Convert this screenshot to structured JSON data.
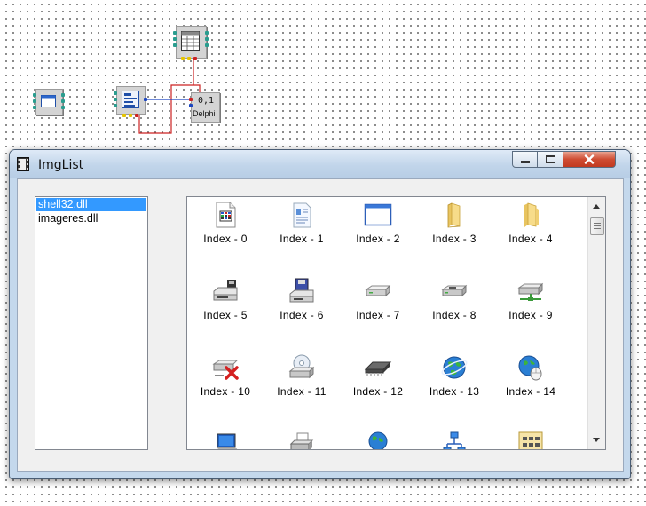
{
  "window": {
    "title": "ImgList",
    "minimize_label": "minimize",
    "maximize_label": "maximize",
    "close_label": "close"
  },
  "canvas": {
    "delphi_node_label": "Delphi",
    "delphi_node_digits": "0,1"
  },
  "dll_list": {
    "items": [
      "shell32.dll",
      "imageres.dll"
    ],
    "selected": "shell32.dll"
  },
  "icons": [
    {
      "label": "Index - 0",
      "icon": "document-chart-icon"
    },
    {
      "label": "Index - 1",
      "icon": "document-text-icon"
    },
    {
      "label": "Index - 2",
      "icon": "window-icon"
    },
    {
      "label": "Index - 3",
      "icon": "folder-icon"
    },
    {
      "label": "Index - 4",
      "icon": "folder-open-icon"
    },
    {
      "label": "Index - 5",
      "icon": "floppy-drive-icon"
    },
    {
      "label": "Index - 6",
      "icon": "floppy-disk-icon"
    },
    {
      "label": "Index - 7",
      "icon": "hard-drive-icon"
    },
    {
      "label": "Index - 8",
      "icon": "removable-drive-icon"
    },
    {
      "label": "Index - 9",
      "icon": "network-drive-icon"
    },
    {
      "label": "Index - 10",
      "icon": "network-drive-disconnected-icon"
    },
    {
      "label": "Index - 11",
      "icon": "cd-drive-icon"
    },
    {
      "label": "Index - 12",
      "icon": "memory-chip-icon"
    },
    {
      "label": "Index - 13",
      "icon": "globe-icon"
    },
    {
      "label": "Index - 14",
      "icon": "globe-mouse-icon"
    },
    {
      "label": "",
      "icon": "computer-icon"
    },
    {
      "label": "",
      "icon": "printer-icon"
    },
    {
      "label": "",
      "icon": "network-globe-icon"
    },
    {
      "label": "",
      "icon": "network-nodes-icon"
    },
    {
      "label": "",
      "icon": "control-panel-icon"
    }
  ],
  "colors": {
    "selection": "#3399ff",
    "wire_red": "#cc2222",
    "wire_blue": "#1a44c0"
  }
}
